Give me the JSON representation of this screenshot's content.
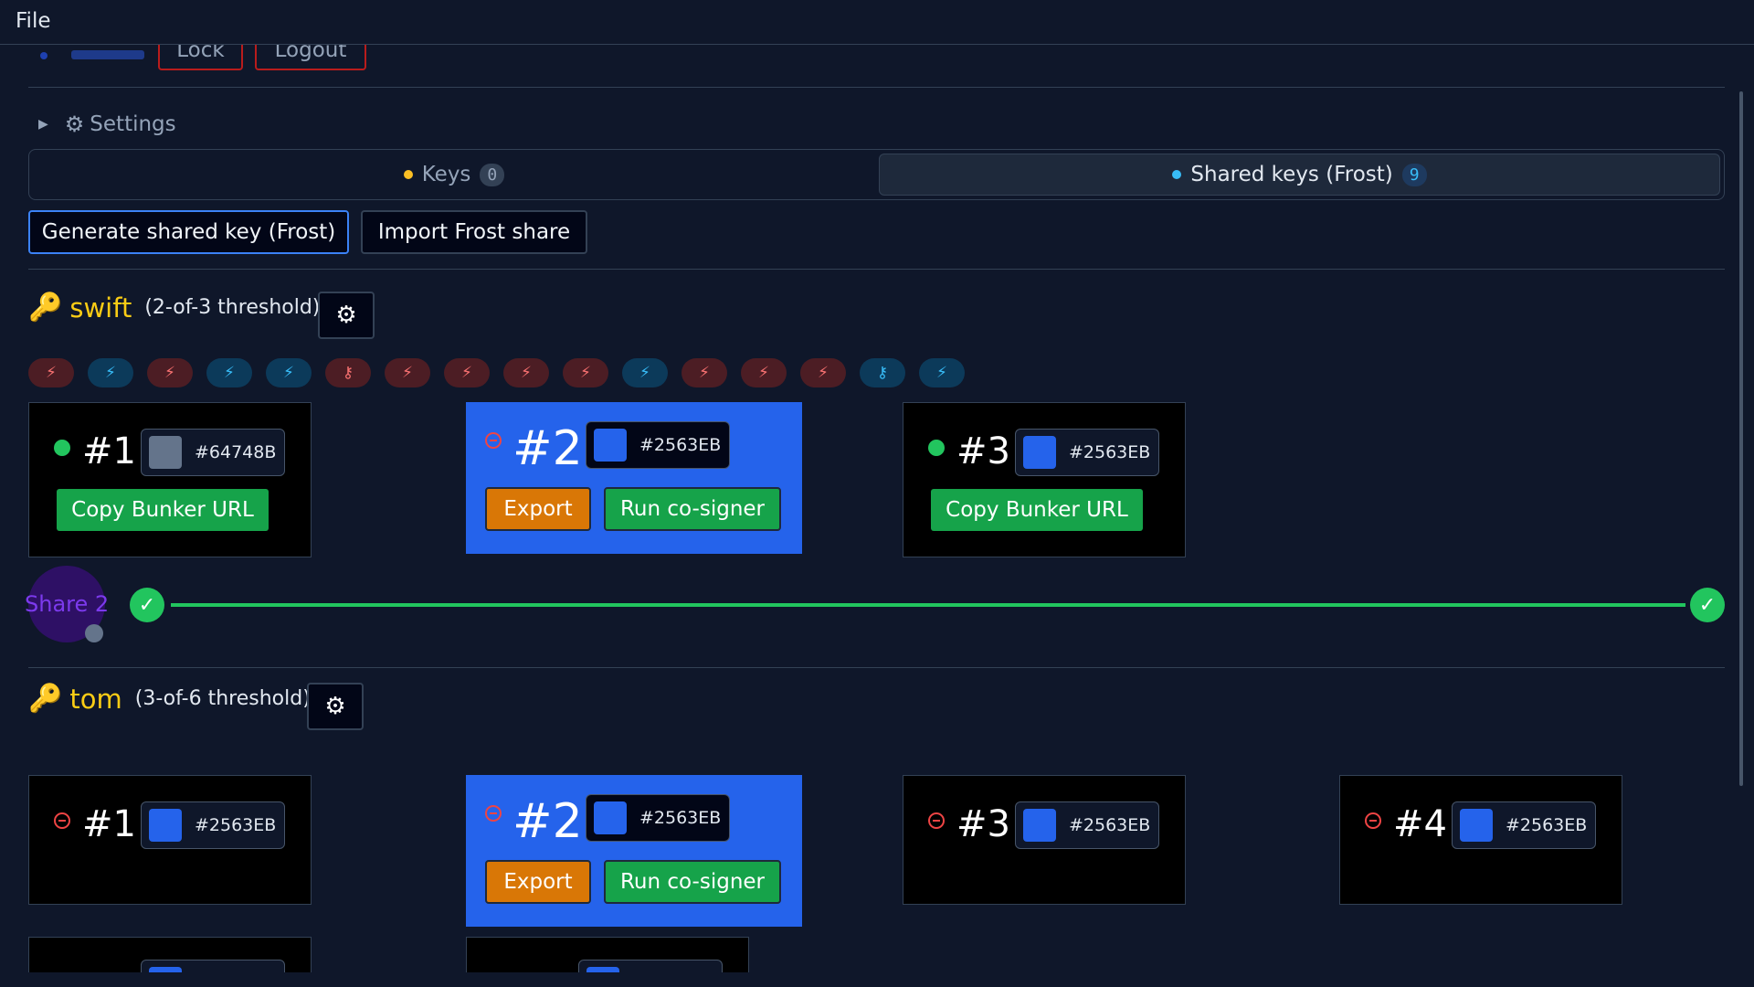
{
  "menu": {
    "file": "File"
  },
  "header_partial": {
    "lock": "Lock",
    "logout": "Logout"
  },
  "settings": {
    "label": "Settings"
  },
  "tabs": [
    {
      "label": "Keys",
      "count": "0",
      "dot": "#fbbf24"
    },
    {
      "label": "Shared keys (Frost)",
      "count": "9",
      "dot": "#38bdf8"
    }
  ],
  "actions": {
    "generate": "Generate shared key (Frost)",
    "import": "Import Frost share"
  },
  "keys": [
    {
      "name": "swift",
      "threshold": "(2-of-3 threshold)",
      "pills": [
        "red",
        "blue",
        "red",
        "blue",
        "blue",
        "red",
        "red",
        "red",
        "red",
        "red",
        "blue",
        "red",
        "red",
        "red",
        "blue",
        "blue"
      ],
      "shares": [
        {
          "num": "#1",
          "status": "online",
          "color": "#64748B",
          "action": "Copy Bunker URL"
        },
        {
          "num": "#2",
          "status": "offline",
          "color": "#2563EB",
          "active": true,
          "export": "Export",
          "cosign": "Run co-signer"
        },
        {
          "num": "#3",
          "status": "online",
          "color": "#2563EB",
          "action": "Copy Bunker URL"
        }
      ],
      "progress": {
        "label": "Share 2",
        "fraction": 1.0
      }
    },
    {
      "name": "tom",
      "threshold": "(3-of-6 threshold)",
      "shares": [
        {
          "num": "#1",
          "status": "offline",
          "color": "#2563EB"
        },
        {
          "num": "#2",
          "status": "offline",
          "color": "#2563EB",
          "active": true,
          "export": "Export",
          "cosign": "Run co-signer"
        },
        {
          "num": "#3",
          "status": "offline",
          "color": "#2563EB"
        },
        {
          "num": "#4",
          "status": "offline",
          "color": "#2563EB"
        }
      ]
    }
  ]
}
